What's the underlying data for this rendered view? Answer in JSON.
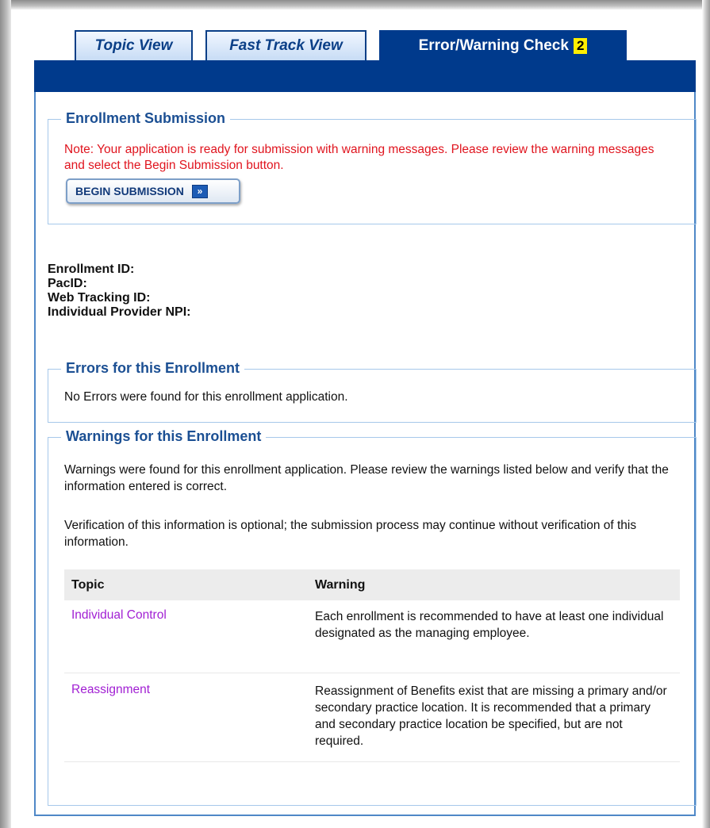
{
  "tabs": [
    {
      "label": "Topic View"
    },
    {
      "label": "Fast Track View"
    },
    {
      "label": "Error/Warning Check",
      "badge": "2"
    }
  ],
  "submission": {
    "legend": "Enrollment Submission",
    "note": "Note: Your application is ready for submission with warning messages. Please review the warning messages and select the Begin Submission button.",
    "button_label": "BEGIN SUBMISSION",
    "button_icon": "double-chevron-right-icon"
  },
  "ids": {
    "enrollment_id": "Enrollment ID:",
    "pac_id": "PacID:",
    "web_tracking_id": "Web Tracking ID:",
    "npi": "Individual Provider NPI:"
  },
  "errors": {
    "legend": "Errors for this Enrollment",
    "text": "No Errors were found for this enrollment application."
  },
  "warnings": {
    "legend": "Warnings for this Enrollment",
    "paragraph1": "Warnings were found for this enrollment application. Please review the warnings listed below and verify that the information entered is correct.",
    "paragraph2": "Verification of this information is optional; the submission process may continue without verification of this information.",
    "table": {
      "headers": [
        "Topic",
        "Warning"
      ],
      "rows": [
        {
          "topic": "Individual Control",
          "warning": "Each enrollment is recommended to have at least one individual designated as the managing employee."
        },
        {
          "topic": "Reassignment",
          "warning": "Reassignment of Benefits exist that are missing a primary and/or secondary practice location. It is recommended that a primary and secondary practice location be specified, but are not required."
        }
      ]
    }
  },
  "colors": {
    "header_blue": "#003a8c",
    "legend_blue": "#1b4f93",
    "note_red": "#e0141e",
    "link_purple": "#a11fd3",
    "badge_yellow": "#ffee00"
  }
}
